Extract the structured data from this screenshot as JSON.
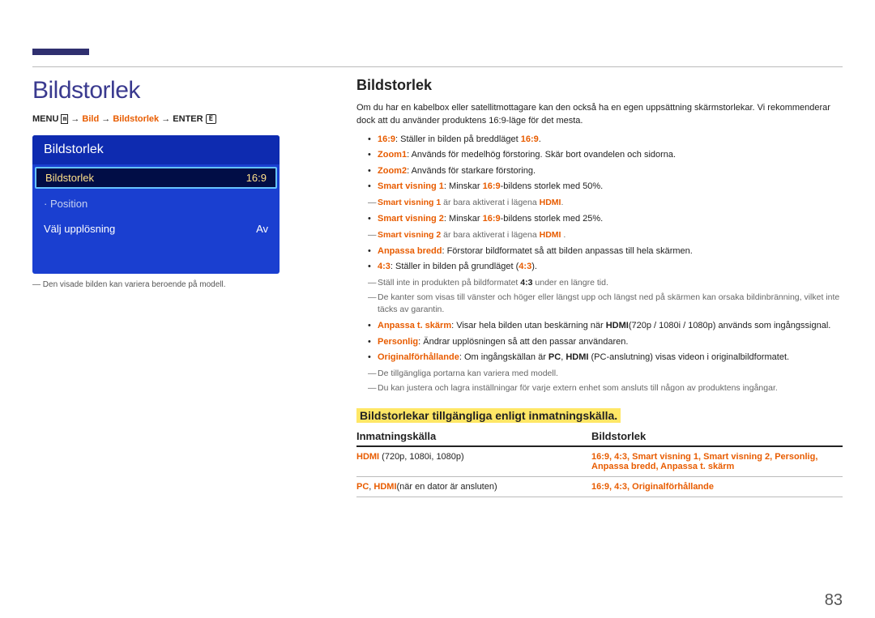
{
  "page_number": "83",
  "main_title": "Bildstorlek",
  "breadcrumb": {
    "menu": "MENU",
    "p1": "Bild",
    "p2": "Bildstorlek",
    "enter": "ENTER"
  },
  "screenshot": {
    "title": "Bildstorlek",
    "rows": [
      {
        "label": "Bildstorlek",
        "value": "16:9",
        "selected": true
      },
      {
        "label": "· Position",
        "value": "",
        "dim": true
      },
      {
        "label": "Välj upplösning",
        "value": "Av"
      }
    ]
  },
  "caption": "Den visade bilden kan variera beroende på modell.",
  "section_title": "Bildstorlek",
  "intro": "Om du har en kabelbox eller satellitmottagare kan den också ha en egen uppsättning skärmstorlekar. Vi rekommenderar dock att du använder produktens 16:9-läge för det mesta.",
  "bullets": {
    "b1": {
      "k": "16:9",
      "t": ": Ställer in bilden på breddläget ",
      "k2": "16:9",
      "t2": "."
    },
    "b2": {
      "k": "Zoom1",
      "t": ": Används för medelhög förstoring. Skär bort ovandelen och sidorna."
    },
    "b3": {
      "k": "Zoom2",
      "t": ": Används för starkare förstoring."
    },
    "b4": {
      "k": "Smart visning 1",
      "t": ": Minskar ",
      "k2": "16:9",
      "t2": "-bildens storlek med 50%."
    },
    "n4": {
      "pre": "Smart visning 1",
      "mid": " är bara aktiverat i lägena ",
      "k": "HDMI",
      "suf": "."
    },
    "b5": {
      "k": "Smart visning 2",
      "t": ": Minskar ",
      "k2": "16:9",
      "t2": "-bildens storlek med 25%."
    },
    "n5": {
      "pre": "Smart visning 2",
      "mid": " är bara aktiverat i lägena ",
      "k": "HDMI",
      "suf": " ."
    },
    "b6": {
      "k": "Anpassa bredd",
      "t": ": Förstorar bildformatet så att bilden anpassas till hela skärmen."
    },
    "b7": {
      "k": "4:3",
      "t": ": Ställer in bilden på grundläget (",
      "k2": "4:3",
      "t2": ")."
    },
    "n7a": {
      "pre": "Ställ inte in produkten på bildformatet ",
      "k": "4:3",
      "suf": " under en längre tid."
    },
    "n7b": "De kanter som visas till vänster och höger eller längst upp och längst ned på skärmen kan orsaka bildinbränning, vilket inte täcks av garantin.",
    "b8": {
      "k": "Anpassa t. skärm",
      "t": ": Visar hela bilden utan beskärning när ",
      "k2": "HDMI",
      "t2": "(720p / 1080i / 1080p) används som ingångssignal."
    },
    "b9": {
      "k": "Personlig",
      "t": ": Ändrar upplösningen så att den passar användaren."
    },
    "b10": {
      "k": "Originalförhållande",
      "t": ": Om ingångskällan är ",
      "k2": "PC",
      "t2": ", ",
      "k3": "HDMI",
      "t3": " (PC-anslutning) visas videon i originalbildformatet."
    },
    "n_last1": "De tillgängliga portarna kan variera med modell.",
    "n_last2": "Du kan justera och lagra inställningar för varje extern enhet som ansluts till någon av produktens ingångar."
  },
  "subheading": "Bildstorlekar tillgängliga enligt inmatningskälla.",
  "table": {
    "h1": "Inmatningskälla",
    "h2": "Bildstorlek",
    "rows": [
      {
        "c1": {
          "k": "HDMI",
          "t": " (720p, 1080i, 1080p)"
        },
        "c2": {
          "full": "16:9, 4:3, Smart visning 1, Smart visning 2, Personlig, Anpassa bredd, Anpassa t. skärm"
        }
      },
      {
        "c1": {
          "k": "PC",
          "s": ", ",
          "k2": "HDMI",
          "t": "(när en dator är ansluten)"
        },
        "c2": {
          "full": "16:9, 4:3, Originalförhållande"
        }
      }
    ]
  }
}
